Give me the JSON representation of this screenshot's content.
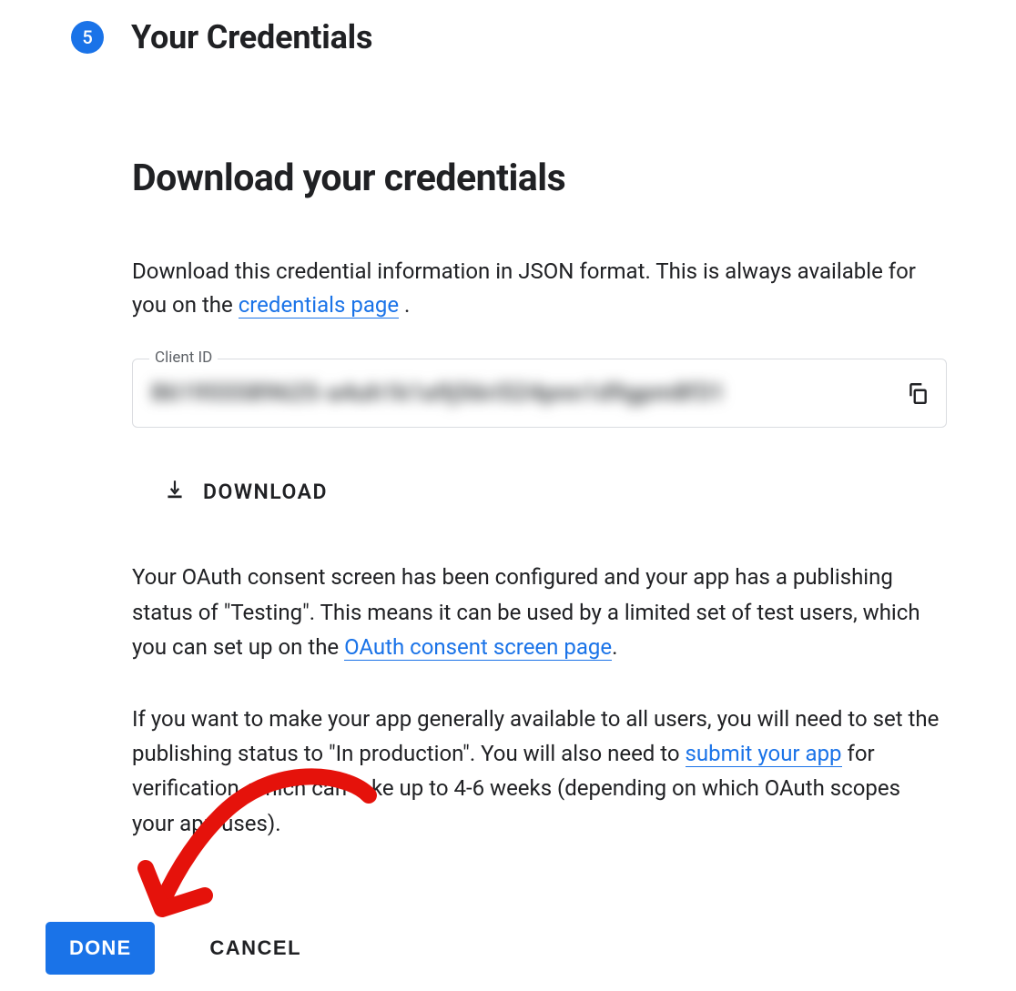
{
  "step": {
    "number": "5",
    "title": "Your Credentials"
  },
  "subtitle": "Download your credentials",
  "intro": {
    "before_link": "Download this credential information in JSON format. This is always available for you on the ",
    "link": "credentials page",
    "after_link": " ."
  },
  "client_id": {
    "label": "Client ID",
    "value": "861955589625-a4uh1k1a9j56ri524pnn1d9gpm8f31"
  },
  "download_label": "DOWNLOAD",
  "para1": {
    "before_link": "Your OAuth consent screen has been configured and your app has a publishing status of \"Testing\". This means it can be used by a limited set of test users, which you can set up on the ",
    "link": "OAuth consent screen page",
    "after_link": "."
  },
  "para2": {
    "before_link": "If you want to make your app generally available to all users, you will need to set the publishing status to \"In production\". You will also need to ",
    "link": "submit your app",
    "after_link": " for verification, which can take up to 4-6 weeks (depending on which OAuth scopes your app uses)."
  },
  "buttons": {
    "done": "DONE",
    "cancel": "CANCEL"
  }
}
